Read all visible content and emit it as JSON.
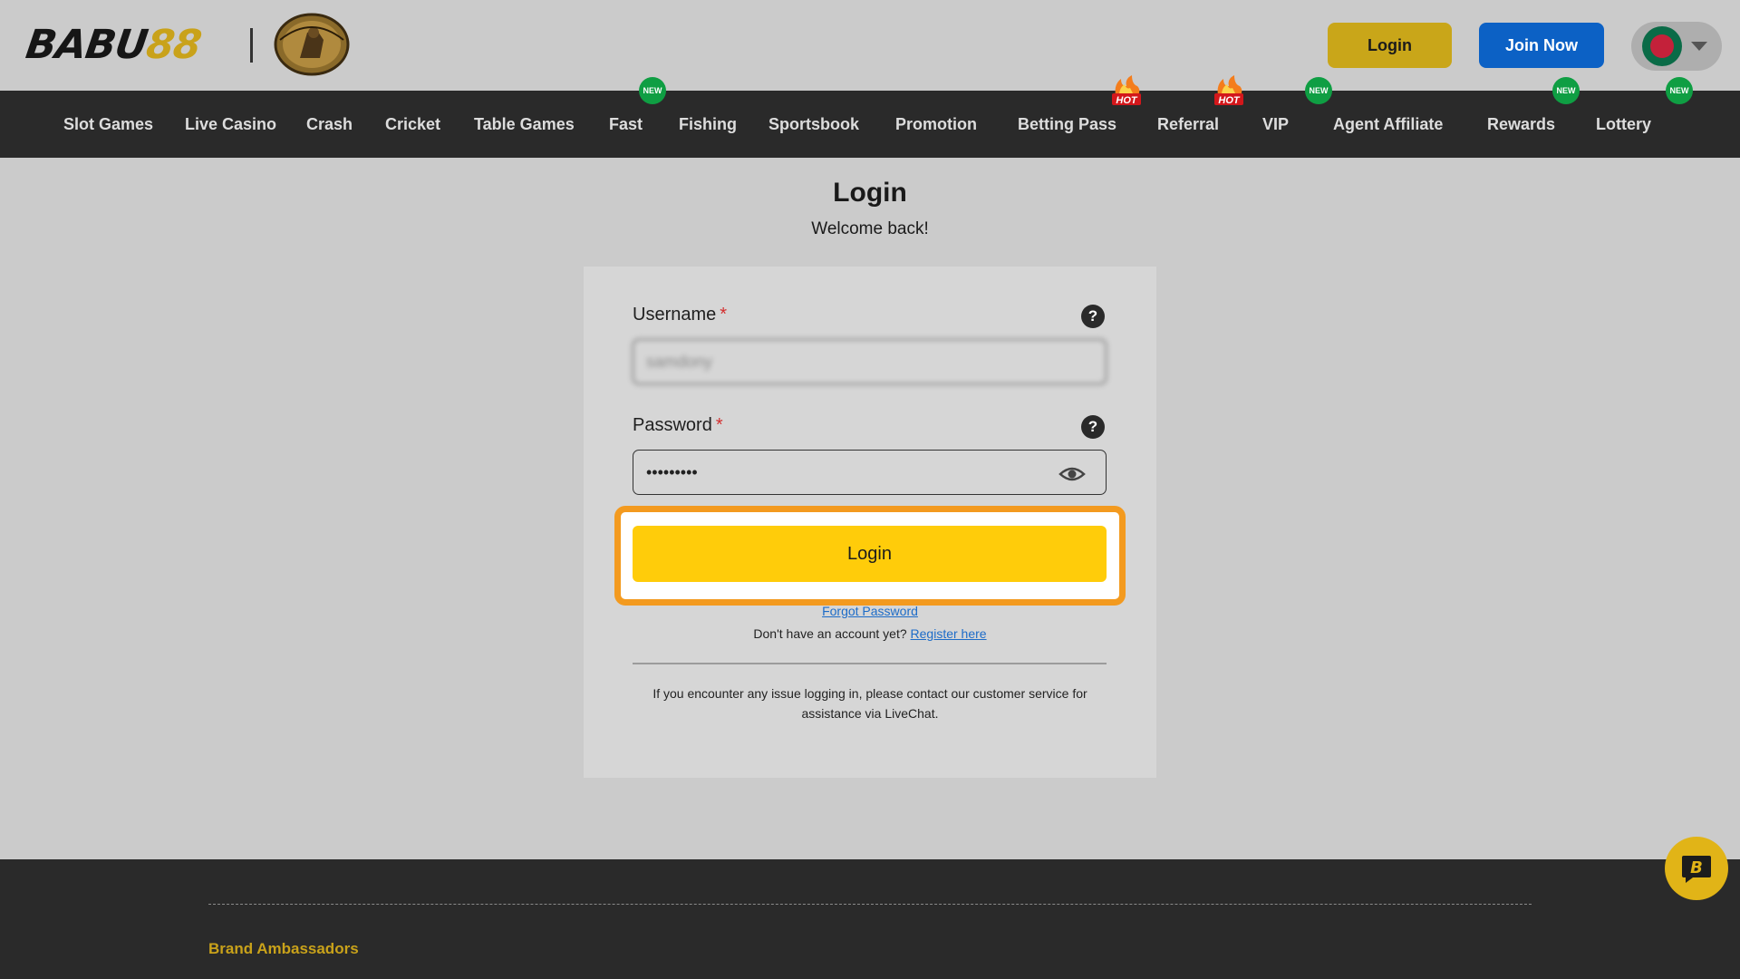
{
  "header": {
    "logo_main": "BABU",
    "logo_num": "88",
    "emblem_name": "northern-warriors-emblem",
    "login_label": "Login",
    "join_label": "Join Now",
    "language_flag": "bangladesh-flag-icon"
  },
  "nav": {
    "items": [
      {
        "label": "Slot Games",
        "badge": ""
      },
      {
        "label": "Live Casino",
        "badge": ""
      },
      {
        "label": "Crash",
        "badge": ""
      },
      {
        "label": "Cricket",
        "badge": ""
      },
      {
        "label": "Table Games",
        "badge": ""
      },
      {
        "label": "Fast",
        "badge": "NEW"
      },
      {
        "label": "Fishing",
        "badge": ""
      },
      {
        "label": "Sportsbook",
        "badge": ""
      },
      {
        "label": "Promotion",
        "badge": ""
      },
      {
        "label": "Betting Pass",
        "badge": "HOT"
      },
      {
        "label": "Referral",
        "badge": "HOT"
      },
      {
        "label": "VIP",
        "badge": "NEW"
      },
      {
        "label": "Agent Affiliate",
        "badge": ""
      },
      {
        "label": "Rewards",
        "badge": "NEW"
      },
      {
        "label": "Lottery",
        "badge": "NEW"
      }
    ],
    "badge_new_label": "NEW",
    "badge_hot_label": "HOT"
  },
  "main": {
    "title": "Login",
    "subtitle": "Welcome back!",
    "username_label": "Username",
    "username_value": "samdony",
    "password_label": "Password",
    "password_value": "•••••••••",
    "required_mark": "*",
    "help_mark": "?",
    "login_button": "Login",
    "forgot_link": "Forgot Password",
    "no_account_text": "Don't have an account yet?",
    "register_link": "Register here",
    "help_text": "If you encounter any issue logging in, please contact our customer service for assistance via LiveChat."
  },
  "footer": {
    "heading": "Brand Ambassadors"
  },
  "colors": {
    "gold": "#c9a21a",
    "join_blue": "#0c61c5",
    "login_yellow": "#ffcc0a",
    "highlight_orange": "#f39a1f",
    "nav_bg": "#2a2a2a",
    "new_badge_green": "#0f9e43",
    "link_blue": "#1d6cc8"
  }
}
